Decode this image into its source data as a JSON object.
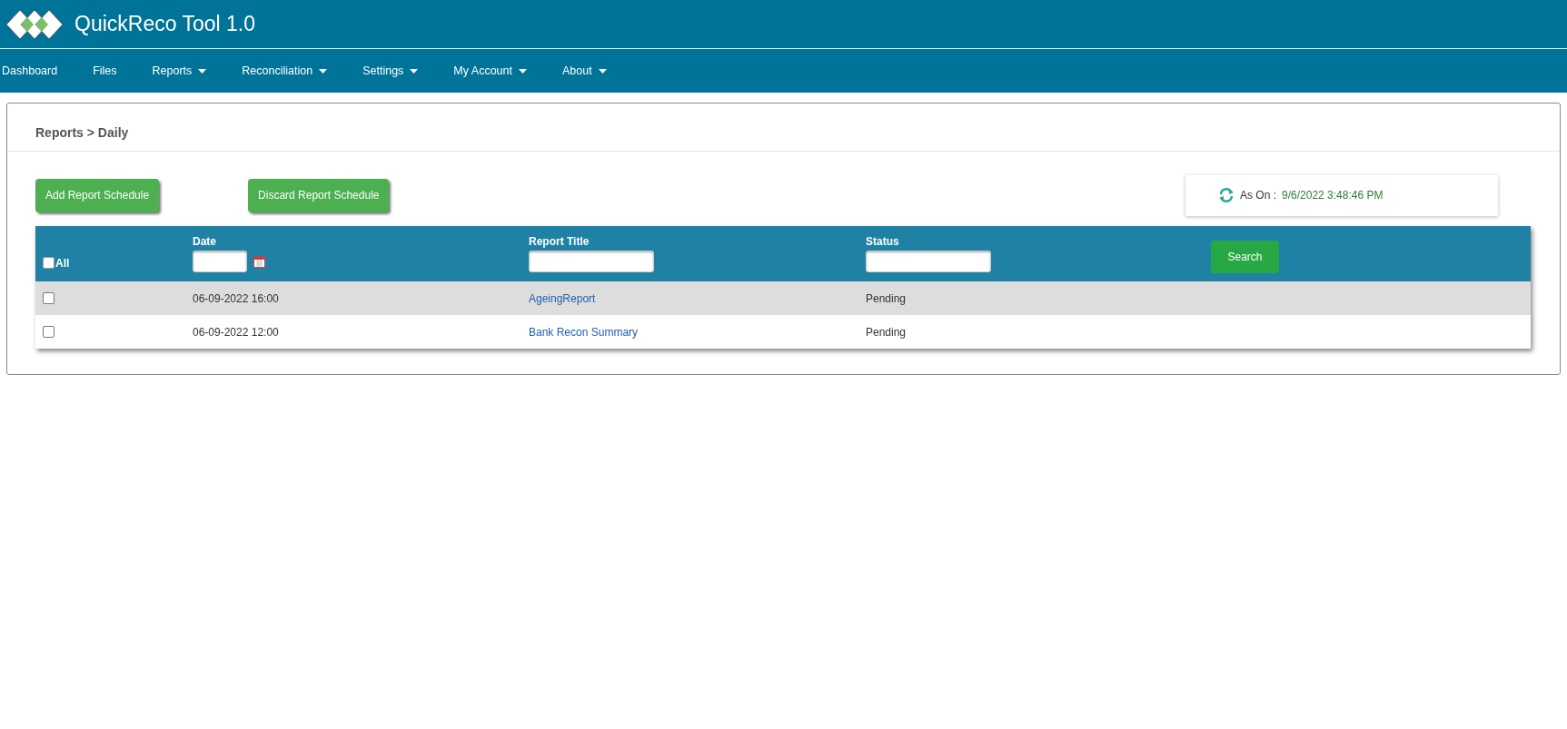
{
  "app": {
    "title": "QuickReco Tool 1.0"
  },
  "nav": [
    {
      "label": "Dashboard",
      "has_menu": false
    },
    {
      "label": "Files",
      "has_menu": false
    },
    {
      "label": "Reports",
      "has_menu": true
    },
    {
      "label": "Reconciliation",
      "has_menu": true
    },
    {
      "label": "Settings",
      "has_menu": true
    },
    {
      "label": "My Account",
      "has_menu": true
    },
    {
      "label": "About",
      "has_menu": true
    }
  ],
  "breadcrumb": "Reports > Daily",
  "actions": [
    "Add Report Schedule",
    "Discard Report Schedule"
  ],
  "as_on": {
    "label": "As On :",
    "value": "9/6/2022 3:48:46 PM"
  },
  "table": {
    "select_all": {
      "label": "All",
      "checked": false
    },
    "columns": [
      "Date",
      "Report Title",
      "Status"
    ],
    "search_button": "Search",
    "rows": [
      {
        "checked": false,
        "date": "06-09-2022 16:00",
        "title": "AgeingReport",
        "status": "Pending"
      },
      {
        "checked": false,
        "date": "06-09-2022 12:00",
        "title": "Bank Recon Summary",
        "status": "Pending"
      }
    ]
  }
}
